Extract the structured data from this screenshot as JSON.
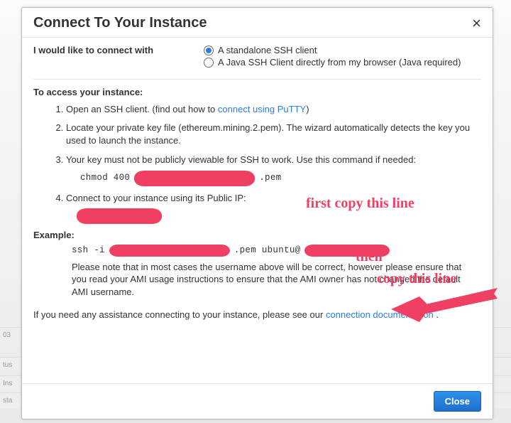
{
  "dialog": {
    "title": "Connect To Your Instance",
    "close_glyph": "×"
  },
  "connect_with": {
    "label": "I would like to connect with",
    "options": {
      "standalone": "A standalone SSH client",
      "java": "A Java SSH Client directly from my browser (Java required)"
    }
  },
  "access": {
    "heading": "To access your instance:",
    "step1_prefix": "Open an SSH client. (find out how to ",
    "step1_link": "connect using PuTTY",
    "step1_suffix": ")",
    "step2": "Locate your private key file (ethereum.mining.2.pem). The wizard automatically detects the key you used to launch the instance.",
    "step3": "Your key must not be publicly viewable for SSH to work. Use this command if needed:",
    "step3_cmd_prefix": "chmod 400 ",
    "step3_cmd_suffix": ".pem",
    "step4": "Connect to your instance using its Public IP:"
  },
  "annotations": {
    "first": "first copy this line",
    "then": "then",
    "copy": "copy this line"
  },
  "example": {
    "label": "Example:",
    "part1": "ssh -i",
    "part2": ".pem ubuntu@",
    "note": "Please note that in most cases the username above will be correct, however please ensure that you read your AMI usage instructions to ensure that the AMI owner has not changed the default AMI username."
  },
  "assist": {
    "prefix": "If you need any assistance connecting to your instance, please see our ",
    "link": "connection documentation",
    "suffix": " ."
  },
  "footer": {
    "close": "Close"
  },
  "bg": {
    "r1": "03",
    "r2": "tus",
    "r3": "Ins",
    "r4": "sta"
  }
}
